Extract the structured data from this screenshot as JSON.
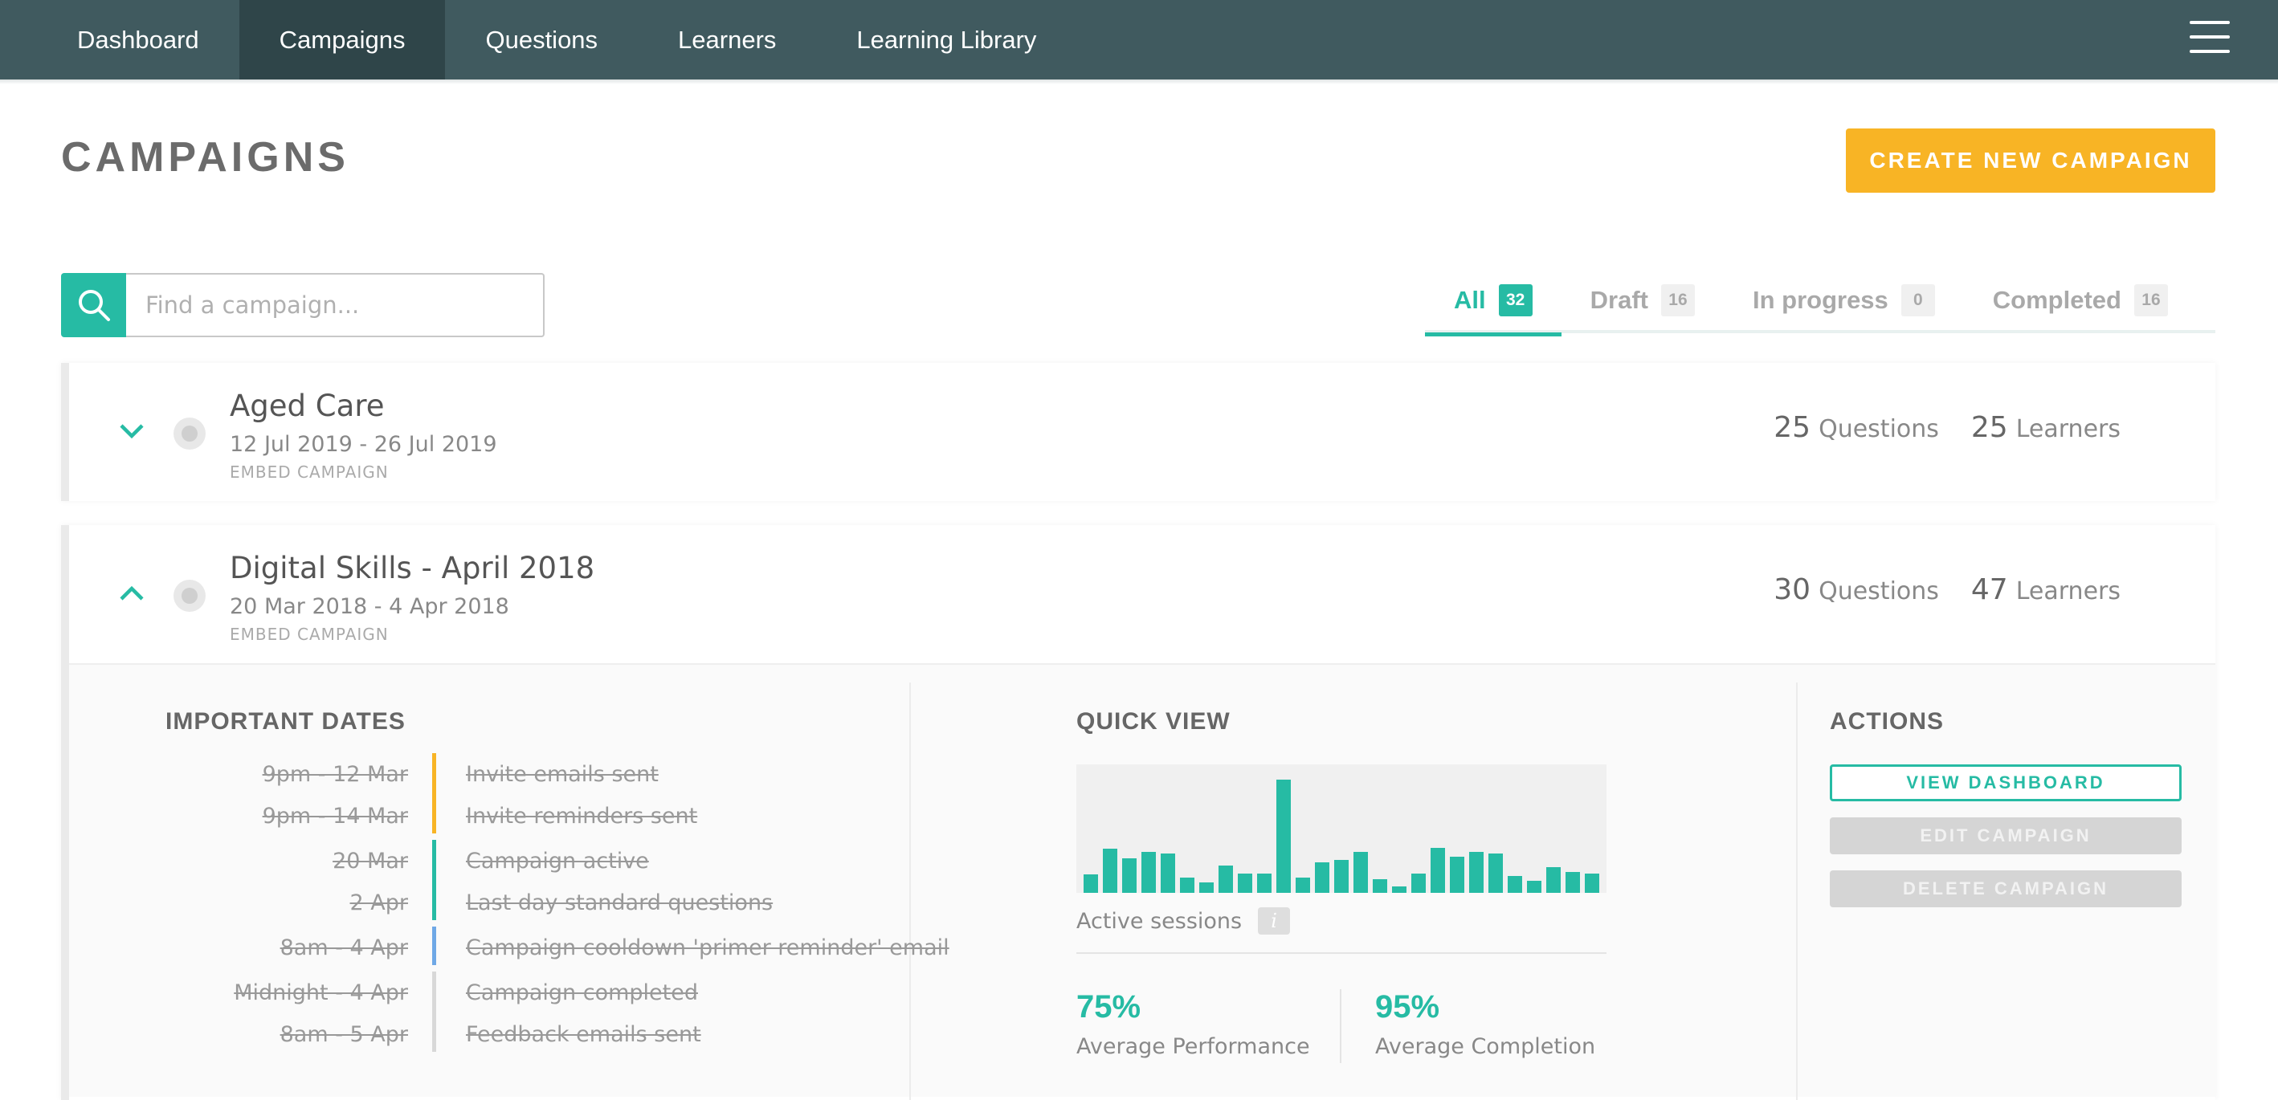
{
  "nav": {
    "items": [
      {
        "label": "Dashboard"
      },
      {
        "label": "Campaigns"
      },
      {
        "label": "Questions"
      },
      {
        "label": "Learners"
      },
      {
        "label": "Learning Library"
      }
    ],
    "active": "Campaigns",
    "menu_icon": "hamburger-icon"
  },
  "header": {
    "title": "CAMPAIGNS",
    "create_label": "CREATE NEW CAMPAIGN"
  },
  "search": {
    "placeholder": "Find a campaign...",
    "value": "",
    "icon": "search-icon"
  },
  "filters": [
    {
      "label": "All",
      "count": "32"
    },
    {
      "label": "Draft",
      "count": "16"
    },
    {
      "label": "In progress",
      "count": "0"
    },
    {
      "label": "Completed",
      "count": "16"
    }
  ],
  "active_filter": "All",
  "campaigns": [
    {
      "name": "Aged Care",
      "dates": "12 Jul 2019 - 26 Jul 2019",
      "type": "EMBED CAMPAIGN",
      "questions": "25",
      "questions_label": "Questions",
      "learners": "25",
      "learners_label": "Learners",
      "expanded": false
    },
    {
      "name": "Digital Skills - April 2018",
      "dates": "20 Mar 2018 - 4 Apr 2018",
      "type": "EMBED CAMPAIGN",
      "questions": "30",
      "questions_label": "Questions",
      "learners": "47",
      "learners_label": "Learners",
      "expanded": true
    }
  ],
  "details": {
    "important_dates_title": "IMPORTANT DATES",
    "dates": [
      {
        "when": "9pm - 12 Mar",
        "event": "Invite emails sent",
        "color": "#f8b425"
      },
      {
        "when": "9pm - 14 Mar",
        "event": "Invite reminders sent",
        "color": "#f8b425"
      },
      {
        "when": "20 Mar",
        "event": "Campaign active",
        "color": "#26bba4"
      },
      {
        "when": "2 Apr",
        "event": "Last day standard questions",
        "color": "#26bba4"
      },
      {
        "when": "8am - 4 Apr",
        "event": "Campaign cooldown 'primer reminder' email",
        "color": "#6fa8e6"
      },
      {
        "when": "Midnight - 4 Apr",
        "event": "Campaign completed",
        "color": "#d8d8d8"
      },
      {
        "when": "8am - 5 Apr",
        "event": "Feedback emails sent",
        "color": "#d8d8d8"
      }
    ],
    "quick_view_title": "QUICK VIEW",
    "sessions_label": "Active sessions",
    "info_glyph": "i",
    "metrics": [
      {
        "value": "75%",
        "label": "Average Performance"
      },
      {
        "value": "95%",
        "label": "Average Completion"
      }
    ],
    "actions_title": "ACTIONS",
    "actions": [
      {
        "label": "VIEW DASHBOARD",
        "style": "primary"
      },
      {
        "label": "EDIT CAMPAIGN",
        "style": "disabled"
      },
      {
        "label": "DELETE CAMPAIGN",
        "style": "disabled"
      }
    ]
  },
  "chart_data": {
    "type": "bar",
    "values": [
      12,
      29,
      23,
      27,
      26,
      10,
      7,
      18,
      13,
      13,
      75,
      10,
      20,
      22,
      27,
      9,
      4,
      13,
      30,
      24,
      27,
      26,
      11,
      8,
      17,
      14,
      13
    ],
    "ylim": [
      0,
      85
    ],
    "xlabel": "Active sessions",
    "grid": false,
    "color": "#26bba4"
  },
  "colors": {
    "nav_bg": "#405a5f",
    "accent": "#26bba4",
    "create_button": "#f8b425"
  }
}
